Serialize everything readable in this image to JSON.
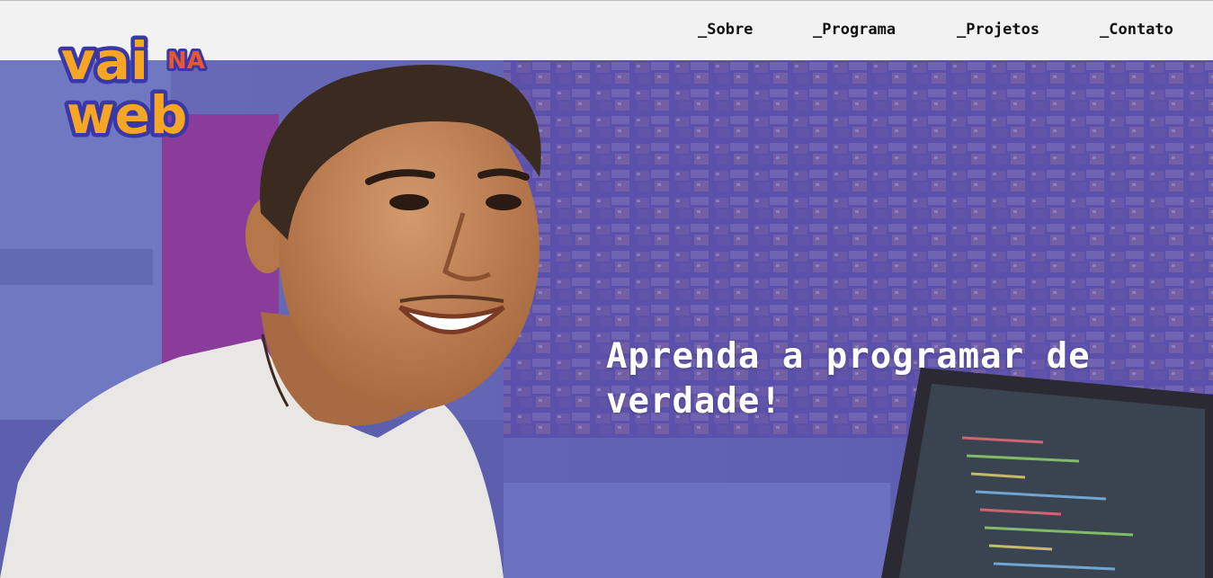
{
  "brand": {
    "logo_text": "vaiNAweb",
    "colors": {
      "primary": "#f6a623",
      "outline": "#3a37a8",
      "accent": "#f6a623"
    }
  },
  "nav": {
    "items": [
      {
        "label": "_Sobre"
      },
      {
        "label": "_Programa"
      },
      {
        "label": "_Projetos"
      },
      {
        "label": "_Contato"
      }
    ]
  },
  "hero": {
    "headline": "Aprenda a programar de verdade!",
    "overlay_color": "#4d4aae"
  }
}
